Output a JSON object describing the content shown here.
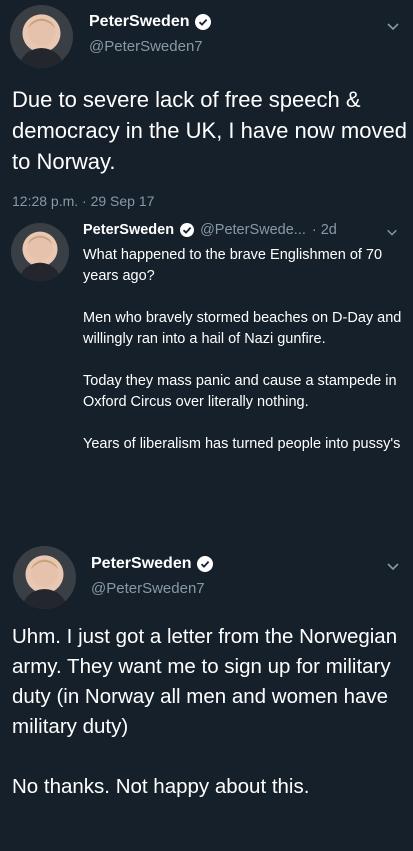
{
  "tweet1": {
    "display_name": "PeterSweden",
    "handle": "@PeterSweden7",
    "text": "Due to severe lack of free speech & democracy in the UK, I have now moved to Norway.",
    "timestamp": "12:28 p.m. · 29 Sep 17"
  },
  "quoted": {
    "display_name": "PeterSweden",
    "handle": "@PeterSwede...",
    "time": "· 2d",
    "paragraphs": [
      "What happened to the brave Englishmen of 70 years ago?",
      "Men who bravely stormed beaches on D-Day and willingly ran into a hail of Nazi gunfire.",
      "Today they mass panic and cause a stampede in Oxford Circus over literally nothing.",
      "Years of liberalism has turned people into pussy's"
    ]
  },
  "tweet2": {
    "display_name": "PeterSweden",
    "handle": "@PeterSweden7",
    "paragraphs": [
      "Uhm. I just got a letter from the Norwegian army. They want me to sign up for military duty (in Norway all men and women have military duty)",
      "No thanks. Not happy about this."
    ]
  },
  "icons": {
    "verified": "verified-check-icon",
    "chevron": "chevron-down-icon"
  },
  "colors": {
    "background": "#15202b",
    "secondary_text": "#8899a6",
    "text": "#ffffff"
  }
}
